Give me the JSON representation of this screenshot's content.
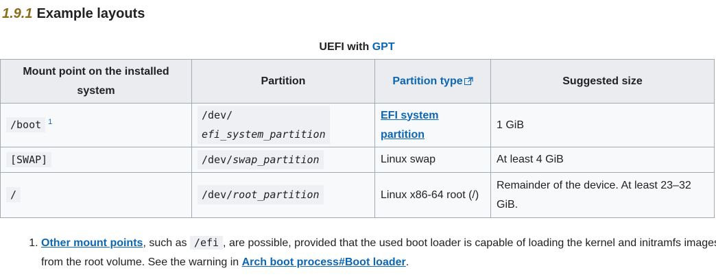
{
  "section": {
    "number": "1.9.1",
    "title": "Example layouts"
  },
  "caption": {
    "prefix": "UEFI with ",
    "link": "GPT"
  },
  "table": {
    "headers": {
      "mount_point": "Mount point on the installed system",
      "partition": "Partition",
      "partition_type": "Partition type",
      "suggested_size": "Suggested size"
    },
    "rows": [
      {
        "mount": "/boot",
        "footnote": "1",
        "partition_prefix": "/dev/",
        "partition_italic": "efi_system_partition",
        "type": "EFI system partition",
        "type_is_link": true,
        "size": "1 GiB"
      },
      {
        "mount": "[SWAP]",
        "partition_prefix": "/dev/",
        "partition_italic": "swap_partition",
        "type": "Linux swap",
        "size": "At least 4 GiB"
      },
      {
        "mount": "/",
        "partition_prefix": "/dev/",
        "partition_italic": "root_partition",
        "type": "Linux x86-64 root (/)",
        "size": "Remainder of the device. At least 23–32 GiB."
      }
    ]
  },
  "notes": {
    "item1": {
      "link1": "Other mount points",
      "text1": ", such as ",
      "code": "/efi",
      "text2": ", are possible, provided that the used boot loader is capable of loading the kernel and initramfs images from the root volume. See the warning in ",
      "link2": "Arch boot process#Boot loader",
      "text3": "."
    }
  },
  "colors": {
    "link": "#0b66b3",
    "section_number": "#8a6d1a",
    "header_bg": "#eaecf0",
    "cell_bg": "#f8f9fa",
    "border": "#a2a9b1"
  },
  "icons": {
    "external_link": "external-link-icon"
  }
}
